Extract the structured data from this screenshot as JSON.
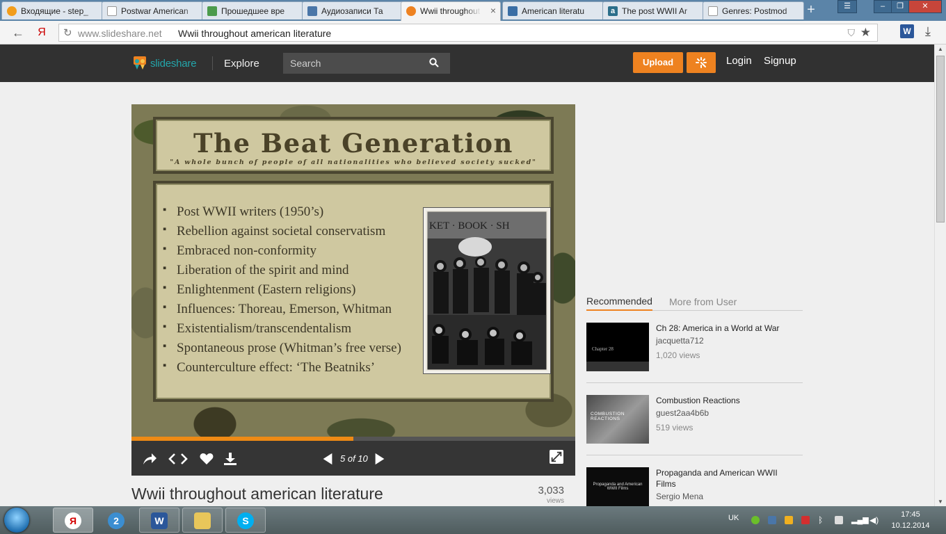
{
  "browser": {
    "tabs": [
      {
        "title": "Входящие - step_",
        "favicon_color": "#f29d1b",
        "active": false
      },
      {
        "title": "Postwar American",
        "favicon_color": "#ffffff",
        "active": false
      },
      {
        "title": "Прошедшее вре",
        "favicon_color": "#4c9b4c",
        "active": false
      },
      {
        "title": "Аудиозаписи Та",
        "favicon_color": "#4a76a8",
        "active": false
      },
      {
        "title": "Wwii throughout",
        "favicon_color": "#ee8220",
        "active": true
      },
      {
        "title": "American literatu",
        "favicon_color": "#3a6ea5",
        "active": false
      },
      {
        "title": "The post WWII Ar",
        "favicon_color": "#2b6e8a",
        "active": false
      },
      {
        "title": "Genres: Postmod",
        "favicon_color": "#ffffff",
        "active": false
      }
    ],
    "url_host": "www.slideshare.net",
    "page_title": "Wwii throughout american literature",
    "yandex_glyph": "Я"
  },
  "site": {
    "logo_text": "slideshare",
    "explore_label": "Explore",
    "search_placeholder": "Search",
    "upload_label": "Upload",
    "login_label": "Login",
    "signup_label": "Signup",
    "accent_color": "#ee8220",
    "brand_color": "#23a6ab"
  },
  "slide": {
    "title": "The Beat Generation",
    "subtitle": "\"A whole bunch of people of all nationalities who believed society sucked\"",
    "bullets": [
      "Post WWII writers (1950’s)",
      "Rebellion against societal conservatism",
      "Embraced non-conformity",
      "Liberation of the spirit and mind",
      "Enlightenment (Eastern religions)",
      "Influences:  Thoreau, Emerson, Whitman",
      "Existentialism/transcendentalism",
      "Spontaneous prose (Whitman’s free verse)",
      "Counterculture effect: ‘The Beatniks’"
    ],
    "photo_sign": "KET · BOOK · SH"
  },
  "player": {
    "current_page": 5,
    "total_pages": 10,
    "page_label": "5 of 10",
    "progress": 0.5
  },
  "document": {
    "title": "Wwii throughout american literature",
    "views": "3,033",
    "views_label": "views"
  },
  "sidebar": {
    "tabs": {
      "recommended": "Recommended",
      "more": "More from User"
    },
    "items": [
      {
        "title": "Ch 28: America in a World at War",
        "author": "jacquetta712",
        "views": "1,020 views",
        "thumb_text": "Chapter 28"
      },
      {
        "title": "Combustion Reactions",
        "author": "guest2aa4b6b",
        "views": "519 views",
        "thumb_text": "COMBUSTION REACTIONS"
      },
      {
        "title": "Propaganda and American WWII Films",
        "author": "Sergio Mena",
        "views": "",
        "thumb_text": "Propaganda and American WWII Films"
      }
    ]
  },
  "taskbar": {
    "lang": "UK",
    "time": "17:45",
    "date": "10.12.2014"
  }
}
